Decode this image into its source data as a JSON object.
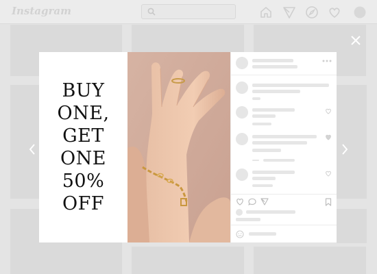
{
  "app": {
    "logo_text": "Instagram"
  },
  "header": {
    "icons": [
      "home-icon",
      "send-icon",
      "compass-icon",
      "heart-icon",
      "avatar"
    ]
  },
  "promo": {
    "lines": [
      "BUY",
      "ONE,",
      "GET",
      "ONE",
      "50%",
      "OFF"
    ]
  },
  "post": {
    "image_subject": "hands wearing gold chain bracelet",
    "action_icons": [
      "heart-icon",
      "comment-icon",
      "share-icon",
      "bookmark-icon"
    ],
    "more_icon": "more-horizontal-icon"
  },
  "modal": {
    "close_icon": "close-icon",
    "prev_icon": "chevron-left-icon",
    "next_icon": "chevron-right-icon"
  },
  "colors": {
    "overlay_bg": "#e4e4e4",
    "modal_bg": "#ffffff",
    "skeleton": "#e6e6e6",
    "text": "#111111",
    "photo_bg": "#d9b8a8"
  }
}
